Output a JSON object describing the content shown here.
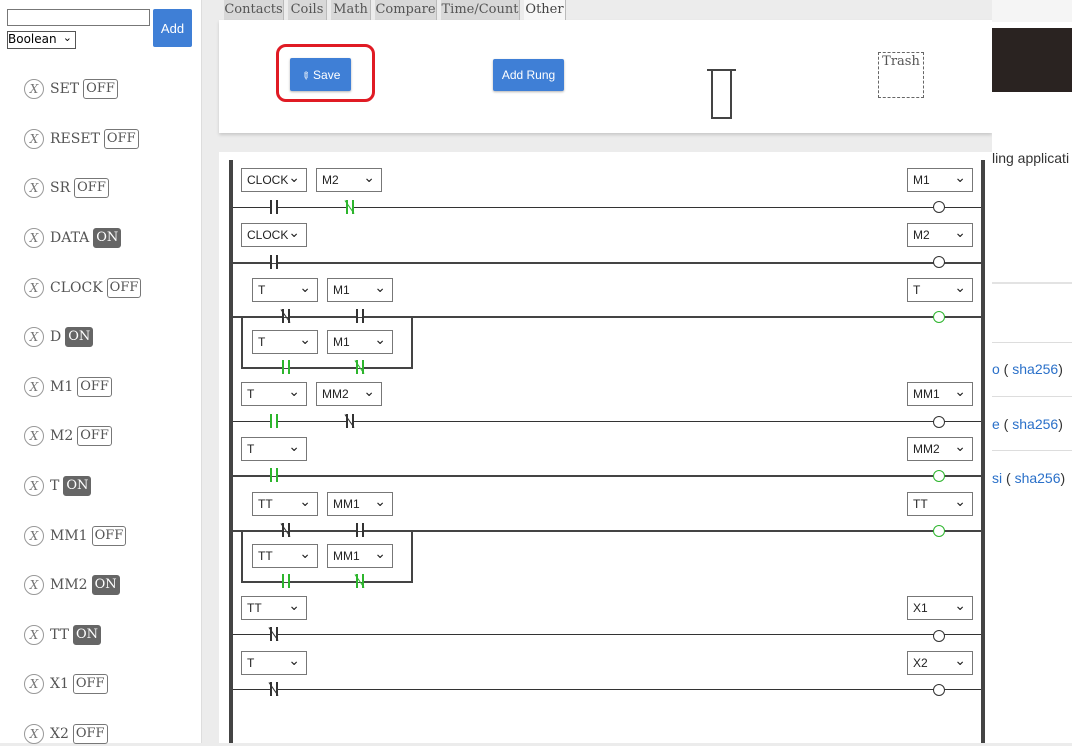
{
  "left_panel": {
    "new_var_value": "",
    "type_select": "Boolean",
    "add_label": "Add",
    "variables": [
      {
        "name": "SET",
        "state": "OFF"
      },
      {
        "name": "RESET",
        "state": "OFF"
      },
      {
        "name": "SR",
        "state": "OFF"
      },
      {
        "name": "DATA",
        "state": "ON"
      },
      {
        "name": "CLOCK",
        "state": "OFF"
      },
      {
        "name": "D",
        "state": "ON"
      },
      {
        "name": "M1",
        "state": "OFF"
      },
      {
        "name": "M2",
        "state": "OFF"
      },
      {
        "name": "T",
        "state": "ON"
      },
      {
        "name": "MM1",
        "state": "OFF"
      },
      {
        "name": "MM2",
        "state": "ON"
      },
      {
        "name": "TT",
        "state": "ON"
      },
      {
        "name": "X1",
        "state": "OFF"
      },
      {
        "name": "X2",
        "state": "OFF"
      }
    ],
    "delete_glyph": "X"
  },
  "tabs": [
    "Contacts",
    "Coils",
    "Math",
    "Compare",
    "Time/Count",
    "Other"
  ],
  "toolbar": {
    "save_label": "Save",
    "add_rung_label": "Add Rung",
    "trash_label": "Trash"
  },
  "ladder": {
    "rungs": [
      {
        "contacts": [
          "CLOCK",
          "M2"
        ],
        "coil": "M1"
      },
      {
        "contacts": [
          "CLOCK"
        ],
        "coil": "M2"
      },
      {
        "contacts": [
          "T",
          "M1"
        ],
        "branch": [
          "T",
          "M1"
        ],
        "coil": "T"
      },
      {
        "contacts": [
          "T",
          "MM2"
        ],
        "coil": "MM1"
      },
      {
        "contacts": [
          "T"
        ],
        "coil": "MM2"
      },
      {
        "contacts": [
          "TT",
          "MM1"
        ],
        "branch": [
          "TT",
          "MM1"
        ],
        "coil": "TT"
      },
      {
        "contacts": [
          "TT"
        ],
        "coil": "X1"
      },
      {
        "contacts": [
          "T"
        ],
        "coil": "X2"
      }
    ]
  },
  "right_strip": {
    "text1": "ling applicati",
    "links": [
      {
        "prefix": "o",
        "label": "sha256"
      },
      {
        "prefix": "e",
        "label": "sha256"
      },
      {
        "prefix": "si",
        "label": "sha256"
      }
    ]
  },
  "colors": {
    "accent": "#3f7fd6",
    "highlight": "#e01b24",
    "energized": "#2db52d"
  }
}
